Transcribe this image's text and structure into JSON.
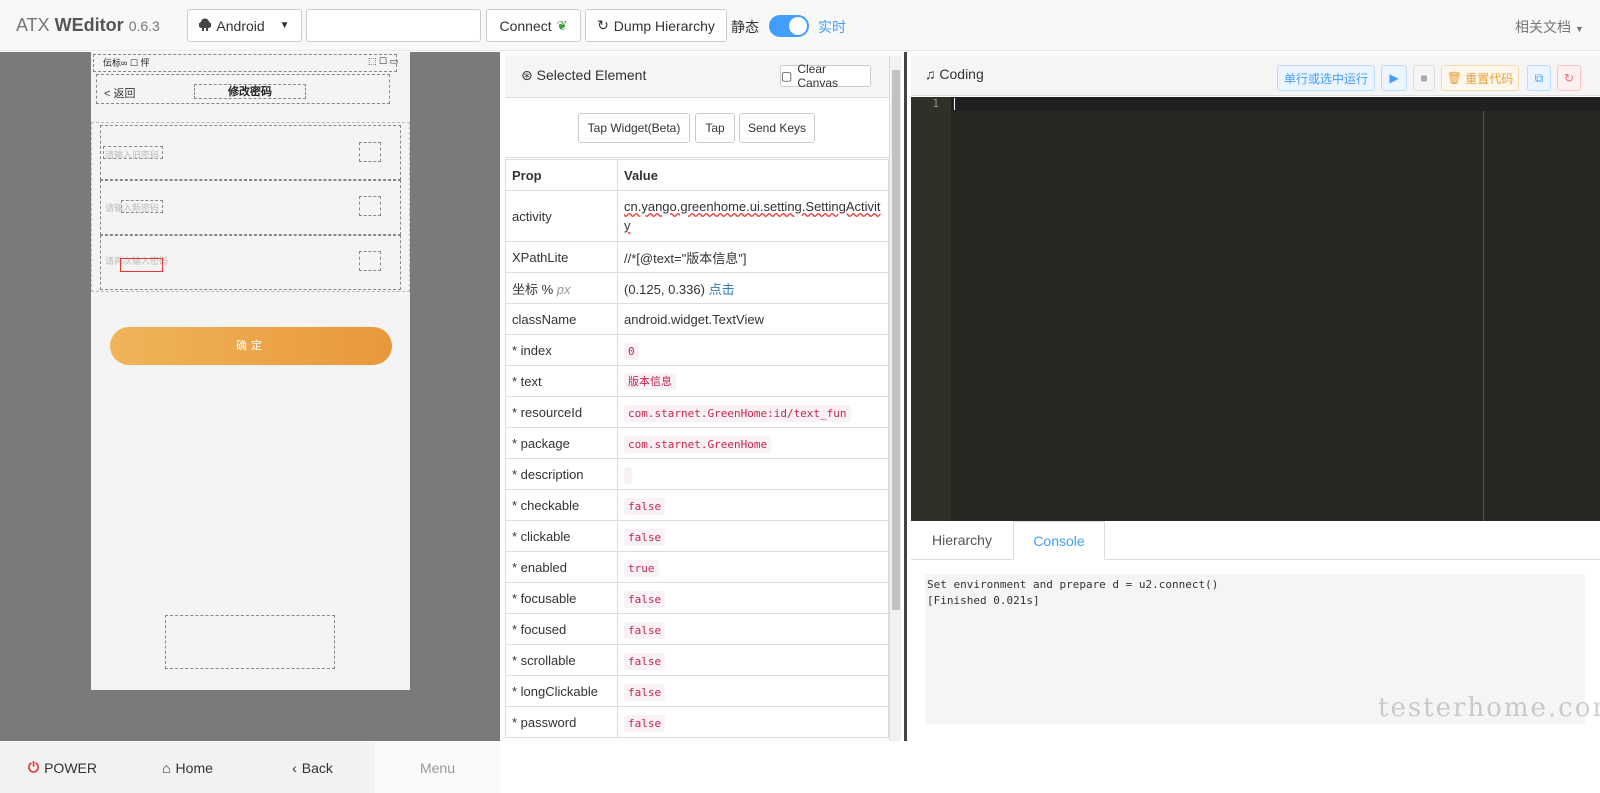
{
  "app": {
    "name_light": "ATX ",
    "name_bold": "WEditor",
    "version": "0.6.3"
  },
  "toolbar": {
    "platform": "Android",
    "serial_value": "",
    "connect_label": "Connect",
    "dump_label": "Dump Hierarchy",
    "mode_static": "静态",
    "mode_live": "实时",
    "docs_label": "相关文档"
  },
  "device": {
    "status_left": "伝标∞ ☐ 怦",
    "status_right": "⬚ ☐ ▭",
    "back_label": "< 返回",
    "page_title": "修改密码",
    "hint1": "请输入旧密码",
    "hint2": "请输入新密码",
    "hint3": "请再次输入密码",
    "confirm_label": "确定"
  },
  "device_bar": {
    "power": "POWER",
    "home": "Home",
    "back": "Back",
    "menu": "Menu"
  },
  "props": {
    "header_title": "Selected Element",
    "clear_canvas": "Clear Canvas",
    "tap_widget": "Tap Widget(Beta)",
    "tap": "Tap",
    "send_keys": "Send Keys",
    "col_prop": "Prop",
    "col_value": "Value",
    "activity_key": "activity",
    "activity_val": "cn.yango.greenhome.ui.setting.SettingActivity",
    "xpath_key": "XPathLite",
    "xpath_val": "//*[@text=\"版本信息\"]",
    "coord_key": "坐标 %",
    "coord_unit": "px",
    "coord_val": "(0.125, 0.336)",
    "coord_click": "点击",
    "class_key": "className",
    "class_val": "android.widget.TextView",
    "rows": [
      {
        "key": "* index",
        "val": "0"
      },
      {
        "key": "* text",
        "val": "版本信息"
      },
      {
        "key": "* resourceId",
        "val": "com.starnet.GreenHome:id/text_fun"
      },
      {
        "key": "* package",
        "val": "com.starnet.GreenHome"
      },
      {
        "key": "* description",
        "val": ""
      },
      {
        "key": "* checkable",
        "val": "false"
      },
      {
        "key": "* clickable",
        "val": "false"
      },
      {
        "key": "* enabled",
        "val": "true"
      },
      {
        "key": "* focusable",
        "val": "false"
      },
      {
        "key": "* focused",
        "val": "false"
      },
      {
        "key": "* scrollable",
        "val": "false"
      },
      {
        "key": "* longClickable",
        "val": "false"
      },
      {
        "key": "* password",
        "val": "false"
      }
    ]
  },
  "coding": {
    "title": "Coding",
    "run_label": "单行或选中运行",
    "reset_label": "重置代码",
    "line_number": "1",
    "tab_hierarchy": "Hierarchy",
    "tab_console": "Console",
    "console_line1": "Set environment and prepare d = u2.connect()",
    "console_line2": "[Finished 0.021s]"
  },
  "watermark": "testerhome.com",
  "colors": {
    "accent": "#409eff",
    "editor_bg": "#272822",
    "code_red": "#c7254e"
  }
}
